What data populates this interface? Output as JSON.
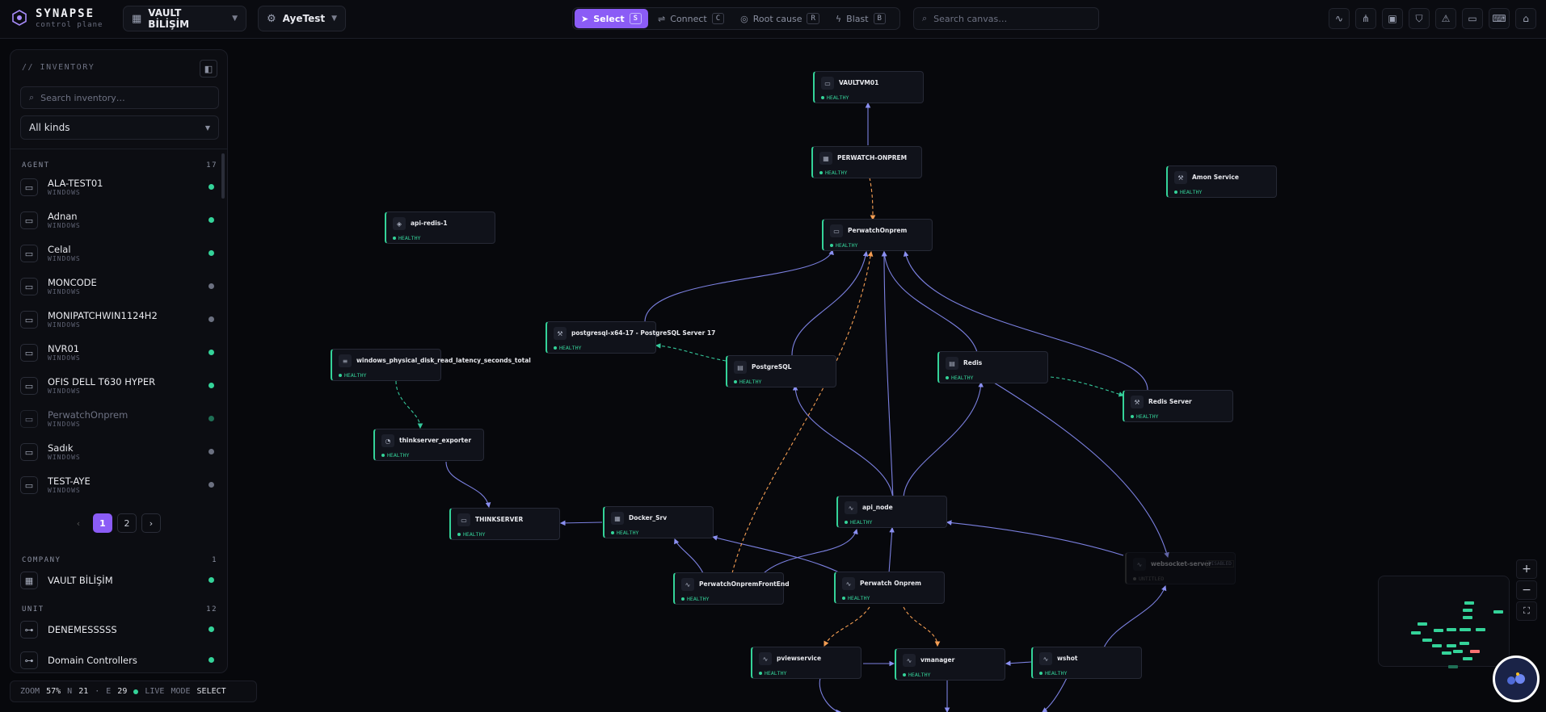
{
  "brand": {
    "name": "SYNAPSE",
    "sub": "control plane"
  },
  "workspace": "VAULT BİLİŞİM",
  "project": "AyeTest",
  "modes": [
    {
      "label": "Select",
      "key": "S",
      "active": true
    },
    {
      "label": "Connect",
      "key": "C"
    },
    {
      "label": "Root cause",
      "key": "R"
    },
    {
      "label": "Blast",
      "key": "B"
    }
  ],
  "search": {
    "placeholder": "Search canvas…"
  },
  "inventory": {
    "title": "// INVENTORY",
    "search_placeholder": "Search inventory…",
    "filter": "All kinds",
    "sections": [
      {
        "name": "AGENT",
        "count": "17"
      },
      {
        "name": "COMPANY",
        "count": "1"
      },
      {
        "name": "UNIT",
        "count": "12"
      }
    ],
    "agents": [
      {
        "name": "ALA-TEST01",
        "sub": "WINDOWS",
        "status": "green"
      },
      {
        "name": "Adnan",
        "sub": "WINDOWS",
        "status": "green"
      },
      {
        "name": "Celal",
        "sub": "WINDOWS",
        "status": "green"
      },
      {
        "name": "MONCODE",
        "sub": "WINDOWS",
        "status": "gray"
      },
      {
        "name": "MONIPATCHWIN1124H2",
        "sub": "WINDOWS",
        "status": "gray"
      },
      {
        "name": "NVR01",
        "sub": "WINDOWS",
        "status": "green"
      },
      {
        "name": "OFIS DELL T630 HYPER",
        "sub": "WINDOWS",
        "status": "green"
      },
      {
        "name": "PerwatchOnprem",
        "sub": "WINDOWS",
        "status": "green"
      },
      {
        "name": "Sadık",
        "sub": "WINDOWS",
        "status": "gray"
      },
      {
        "name": "TEST-AYE",
        "sub": "WINDOWS",
        "status": "gray"
      }
    ],
    "pages": [
      "1",
      "2"
    ],
    "company": [
      {
        "name": "VAULT BİLİŞİM",
        "status": "green"
      }
    ],
    "units": [
      {
        "name": "DENEMESSSSS",
        "status": "green"
      },
      {
        "name": "Domain Controllers",
        "status": "green"
      }
    ]
  },
  "status": {
    "zoom_label": "ZOOM",
    "zoom": "57%",
    "n_label": "N",
    "nodes": "21",
    "e_label": "E",
    "edges": "29",
    "live": "LIVE",
    "mode_label": "MODE",
    "mode": "SELECT"
  },
  "nodes": [
    {
      "id": "vaultvm01",
      "label": "VAULTVM01",
      "status": "HEALTHY",
      "icon": "monitor-icon"
    },
    {
      "id": "perwatch-onprem-top",
      "label": "PERWATCH-ONPREM",
      "status": "HEALTHY",
      "icon": "docker-icon"
    },
    {
      "id": "amon-service",
      "label": "Amon Service",
      "status": "HEALTHY",
      "icon": "wrench-icon"
    },
    {
      "id": "api-redis-1",
      "label": "api-redis-1",
      "status": "HEALTHY",
      "icon": "cube-icon"
    },
    {
      "id": "perwatchonprem",
      "label": "PerwatchOnprem",
      "status": "HEALTHY",
      "icon": "monitor-icon"
    },
    {
      "id": "postgresql-x64",
      "label": "postgresql-x64-17 - PostgreSQL Server 17",
      "status": "HEALTHY",
      "icon": "wrench-icon"
    },
    {
      "id": "win-disk-metric",
      "label": "windows_physical_disk_read_latency_seconds_total",
      "status": "HEALTHY",
      "icon": "list-icon"
    },
    {
      "id": "postgresql",
      "label": "PostgreSQL",
      "status": "HEALTHY",
      "icon": "database-icon"
    },
    {
      "id": "redis",
      "label": "Redis",
      "status": "HEALTHY",
      "icon": "database-icon"
    },
    {
      "id": "redis-server",
      "label": "Redis Server",
      "status": "HEALTHY",
      "icon": "wrench-icon"
    },
    {
      "id": "thinkserver-exporter",
      "label": "thinkserver_exporter",
      "status": "HEALTHY",
      "icon": "gauge-icon"
    },
    {
      "id": "thinkserver",
      "label": "THINKSERVER",
      "status": "HEALTHY",
      "icon": "monitor-icon"
    },
    {
      "id": "docker-srv",
      "label": "Docker_Srv",
      "status": "HEALTHY",
      "icon": "docker-icon"
    },
    {
      "id": "api-node",
      "label": "api_node",
      "status": "HEALTHY",
      "icon": "pulse-icon"
    },
    {
      "id": "websocket-server",
      "label": "websocket-server",
      "status": "UNTITLED",
      "icon": "pulse-icon",
      "badge": "DISABLED"
    },
    {
      "id": "perwatch-frontend",
      "label": "PerwatchOnpremFrontEnd",
      "status": "HEALTHY",
      "icon": "pulse-icon"
    },
    {
      "id": "perwatch-onprem-svc",
      "label": "Perwatch Onprem",
      "status": "HEALTHY",
      "icon": "pulse-icon"
    },
    {
      "id": "pviewservice",
      "label": "pviewservice",
      "status": "HEALTHY",
      "icon": "pulse-icon"
    },
    {
      "id": "vmanager",
      "label": "vmanager",
      "status": "HEALTHY",
      "icon": "pulse-icon"
    },
    {
      "id": "wshot",
      "label": "wshot",
      "status": "HEALTHY",
      "icon": "pulse-icon"
    }
  ],
  "colors": {
    "accent": "#8b5cf6",
    "healthy": "#34d399",
    "edge_solid": "#8a8ff0",
    "edge_dashed_orange": "#f59e53",
    "edge_dashed_teal": "#34c79a",
    "offline": "#6b7080"
  }
}
